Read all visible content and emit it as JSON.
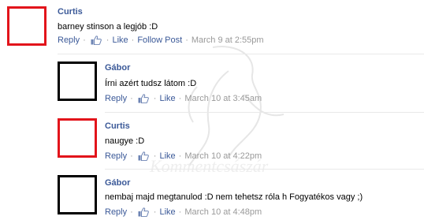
{
  "comments": [
    {
      "author": "Curtis",
      "text": "barney stinson a legjób :D",
      "reply": "Reply",
      "like": "Like",
      "follow": "Follow Post",
      "time": "March 9 at 2:55pm",
      "avatar_color": "#e2141b"
    },
    {
      "author": "Gábor",
      "text": "Írni azért tudsz látom :D",
      "reply": "Reply",
      "like": "Like",
      "time": "March 10 at 3:45am",
      "avatar_color": "#000000"
    },
    {
      "author": "Curtis",
      "text": "naugye :D",
      "reply": "Reply",
      "like": "Like",
      "time": "March 10 at 4:22pm",
      "avatar_color": "#e2141b"
    },
    {
      "author": "Gábor",
      "text": "nembaj majd megtanulod :D nem tehetsz róla h Fogyatékos vagy ;)",
      "reply": "Reply",
      "like": "Like",
      "time": "March 10 at 4:48pm",
      "avatar_color": "#000000"
    }
  ],
  "watermark_text": "Kommentcsászár",
  "icons": {
    "like": "thumbs-up-icon"
  },
  "colors": {
    "link": "#3b5998",
    "meta": "#999999"
  }
}
